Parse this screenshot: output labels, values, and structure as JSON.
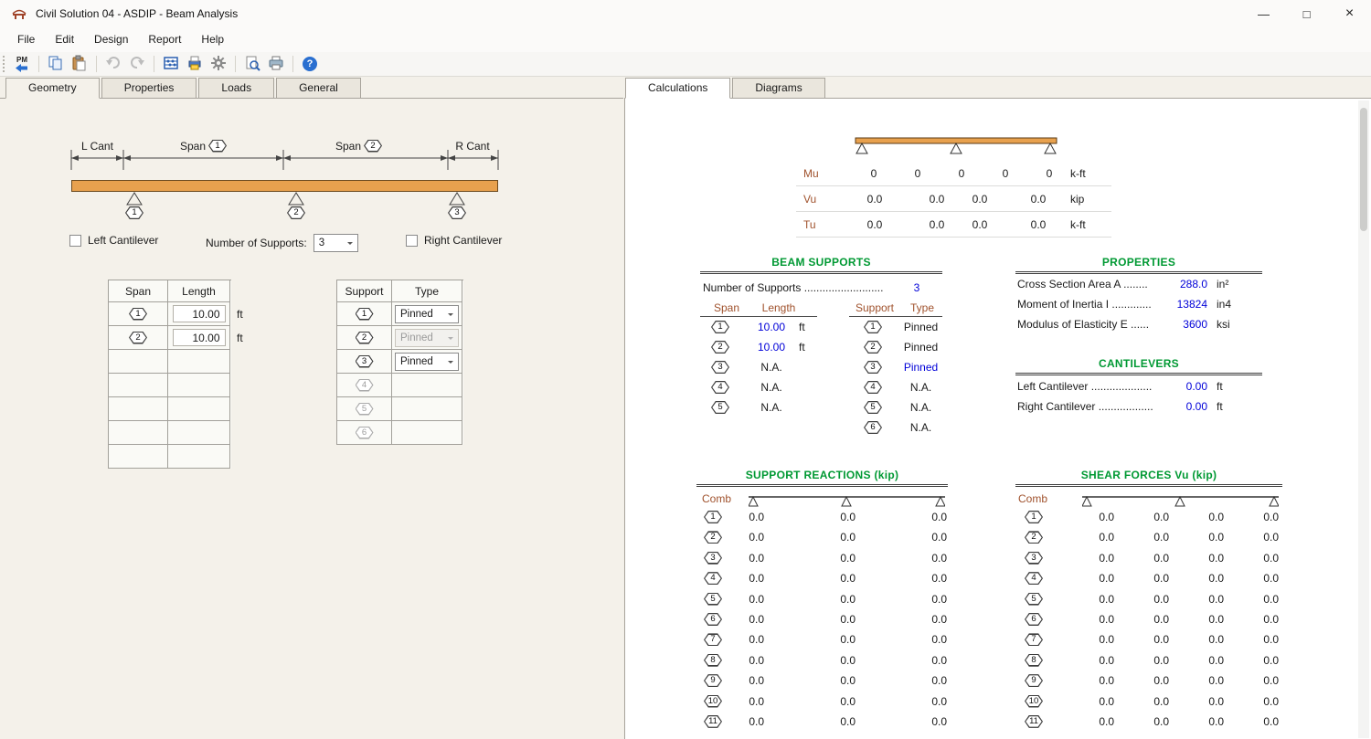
{
  "colors": {
    "accent_green": "#009933",
    "value_blue": "#0000D8",
    "label_brown": "#A0522D",
    "beam_orange": "#E8A14E"
  },
  "window": {
    "title": "Civil Solution 04 - ASDIP - Beam Analysis",
    "minimize_glyph": "—",
    "maximize_glyph": "□",
    "close_glyph": "×"
  },
  "menu": {
    "items": [
      "File",
      "Edit",
      "Design",
      "Report",
      "Help"
    ]
  },
  "toolbar": {
    "pm_label": "PM",
    "help_glyph": "?"
  },
  "left_panel": {
    "tabs": [
      {
        "label": "Geometry",
        "class": "active"
      },
      {
        "label": "Properties",
        "class": ""
      },
      {
        "label": "Loads",
        "class": ""
      },
      {
        "label": "General",
        "class": ""
      }
    ],
    "diagram": {
      "l_cant": "L Cant",
      "span1": "Span",
      "span1_num": "1",
      "span2": "Span",
      "span2_num": "2",
      "r_cant": "R Cant",
      "support_labels": [
        {
          "num": "1"
        },
        {
          "num": "2"
        },
        {
          "num": "3"
        }
      ]
    },
    "controls": {
      "left_cantilever": "Left Cantilever",
      "num_supports_label": "Number of Supports:",
      "num_supports_value": "3",
      "right_cantilever": "Right Cantilever"
    },
    "span_table": {
      "col1": "Span",
      "col2": "Length",
      "rows": [
        {
          "num": "1",
          "value": "10.00",
          "unit": "ft",
          "interactable": "true"
        },
        {
          "num": "2",
          "value": "10.00",
          "unit": "ft",
          "interactable": "true"
        },
        {
          "num": "",
          "value": "",
          "unit": "",
          "interactable": "false"
        },
        {
          "num": "",
          "value": "",
          "unit": "",
          "interactable": "false"
        },
        {
          "num": "",
          "value": "",
          "unit": "",
          "interactable": "false"
        },
        {
          "num": "",
          "value": "",
          "unit": "",
          "interactable": "false"
        },
        {
          "num": "",
          "value": "",
          "unit": "",
          "interactable": "false"
        }
      ]
    },
    "support_table": {
      "col1": "Support",
      "col2": "Type",
      "rows": [
        {
          "num": "1",
          "hex_class": "",
          "type": "Pinned",
          "combo_class": "",
          "interactable": "true"
        },
        {
          "num": "2",
          "hex_class": "",
          "type": "Pinned",
          "combo_class": "disabled",
          "interactable": "false"
        },
        {
          "num": "3",
          "hex_class": "",
          "type": "Pinned",
          "combo_class": "",
          "interactable": "true"
        },
        {
          "num": "4",
          "hex_class": "gray",
          "type": "",
          "combo_class": "hidden",
          "interactable": "false"
        },
        {
          "num": "5",
          "hex_class": "gray",
          "type": "",
          "combo_class": "hidden",
          "interactable": "false"
        },
        {
          "num": "6",
          "hex_class": "gray",
          "type": "",
          "combo_class": "hidden",
          "interactable": "false"
        }
      ]
    }
  },
  "right_panel": {
    "tabs": [
      {
        "label": "Calculations",
        "class": "active"
      },
      {
        "label": "Diagrams",
        "class": ""
      }
    ],
    "summary": {
      "mu": {
        "label": "Mu",
        "v1": "0",
        "v2": "0",
        "v3": "0",
        "v4": "0",
        "v5": "0",
        "unit": "k-ft"
      },
      "vu": {
        "label": "Vu",
        "v1": "0.0",
        "v2": "0.0",
        "v3": "0.0",
        "v4": "0.0",
        "unit": "kip"
      },
      "tu": {
        "label": "Tu",
        "v1": "0.0",
        "v2": "0.0",
        "v3": "0.0",
        "v4": "0.0",
        "unit": "k-ft"
      }
    },
    "beam_supports": {
      "title": "BEAM SUPPORTS",
      "count_label": "Number of Supports ..........................",
      "count_value": "3",
      "span_col1": "Span",
      "span_col2": "Length",
      "spans": [
        {
          "num": "1",
          "value": "10.00",
          "value_class": "blue",
          "unit": "ft"
        },
        {
          "num": "2",
          "value": "10.00",
          "value_class": "blue",
          "unit": "ft"
        },
        {
          "num": "3",
          "value": "N.A.",
          "value_class": "",
          "unit": ""
        },
        {
          "num": "4",
          "value": "N.A.",
          "value_class": "",
          "unit": ""
        },
        {
          "num": "5",
          "value": "N.A.",
          "value_class": "",
          "unit": ""
        }
      ],
      "sup_col1": "Support",
      "sup_col2": "Type",
      "supports": [
        {
          "num": "1",
          "type": "Pinned",
          "type_class": ""
        },
        {
          "num": "2",
          "type": "Pinned",
          "type_class": ""
        },
        {
          "num": "3",
          "type": "Pinned",
          "type_class": "blue"
        },
        {
          "num": "4",
          "type": "N.A.",
          "type_class": ""
        },
        {
          "num": "5",
          "type": "N.A.",
          "type_class": ""
        },
        {
          "num": "6",
          "type": "N.A.",
          "type_class": ""
        }
      ]
    },
    "properties": {
      "title": "PROPERTIES",
      "rows": [
        {
          "label": "Cross Section Area  A ........",
          "value": "288.0",
          "unit": "in²"
        },
        {
          "label": "Moment of Inertia  I .............",
          "value": "13824",
          "unit": "in4"
        },
        {
          "label": "Modulus of Elasticity  E ......",
          "value": "3600",
          "unit": "ksi"
        }
      ]
    },
    "cantilevers": {
      "title": "CANTILEVERS",
      "rows": [
        {
          "label": "Left Cantilever ....................",
          "value": "0.00",
          "unit": "ft"
        },
        {
          "label": "Right Cantilever ..................",
          "value": "0.00",
          "unit": "ft"
        }
      ]
    },
    "support_reactions": {
      "title": "SUPPORT REACTIONS (kip)",
      "comb": "Comb",
      "rows": [
        {
          "num": "1",
          "v1": "0.0",
          "v2": "0.0",
          "v3": "0.0"
        },
        {
          "num": "2",
          "v1": "0.0",
          "v2": "0.0",
          "v3": "0.0"
        },
        {
          "num": "3",
          "v1": "0.0",
          "v2": "0.0",
          "v3": "0.0"
        },
        {
          "num": "4",
          "v1": "0.0",
          "v2": "0.0",
          "v3": "0.0"
        },
        {
          "num": "5",
          "v1": "0.0",
          "v2": "0.0",
          "v3": "0.0"
        },
        {
          "num": "6",
          "v1": "0.0",
          "v2": "0.0",
          "v3": "0.0"
        },
        {
          "num": "7",
          "v1": "0.0",
          "v2": "0.0",
          "v3": "0.0"
        },
        {
          "num": "8",
          "v1": "0.0",
          "v2": "0.0",
          "v3": "0.0"
        },
        {
          "num": "9",
          "v1": "0.0",
          "v2": "0.0",
          "v3": "0.0"
        },
        {
          "num": "10",
          "v1": "0.0",
          "v2": "0.0",
          "v3": "0.0"
        },
        {
          "num": "11",
          "v1": "0.0",
          "v2": "0.0",
          "v3": "0.0"
        }
      ]
    },
    "shear_forces": {
      "title": "SHEAR FORCES Vu (kip)",
      "comb": "Comb",
      "rows": [
        {
          "num": "1",
          "v1": "0.0",
          "v2": "0.0",
          "v3": "0.0",
          "v4": "0.0"
        },
        {
          "num": "2",
          "v1": "0.0",
          "v2": "0.0",
          "v3": "0.0",
          "v4": "0.0"
        },
        {
          "num": "3",
          "v1": "0.0",
          "v2": "0.0",
          "v3": "0.0",
          "v4": "0.0"
        },
        {
          "num": "4",
          "v1": "0.0",
          "v2": "0.0",
          "v3": "0.0",
          "v4": "0.0"
        },
        {
          "num": "5",
          "v1": "0.0",
          "v2": "0.0",
          "v3": "0.0",
          "v4": "0.0"
        },
        {
          "num": "6",
          "v1": "0.0",
          "v2": "0.0",
          "v3": "0.0",
          "v4": "0.0"
        },
        {
          "num": "7",
          "v1": "0.0",
          "v2": "0.0",
          "v3": "0.0",
          "v4": "0.0"
        },
        {
          "num": "8",
          "v1": "0.0",
          "v2": "0.0",
          "v3": "0.0",
          "v4": "0.0"
        },
        {
          "num": "9",
          "v1": "0.0",
          "v2": "0.0",
          "v3": "0.0",
          "v4": "0.0"
        },
        {
          "num": "10",
          "v1": "0.0",
          "v2": "0.0",
          "v3": "0.0",
          "v4": "0.0"
        },
        {
          "num": "11",
          "v1": "0.0",
          "v2": "0.0",
          "v3": "0.0",
          "v4": "0.0"
        }
      ]
    }
  }
}
